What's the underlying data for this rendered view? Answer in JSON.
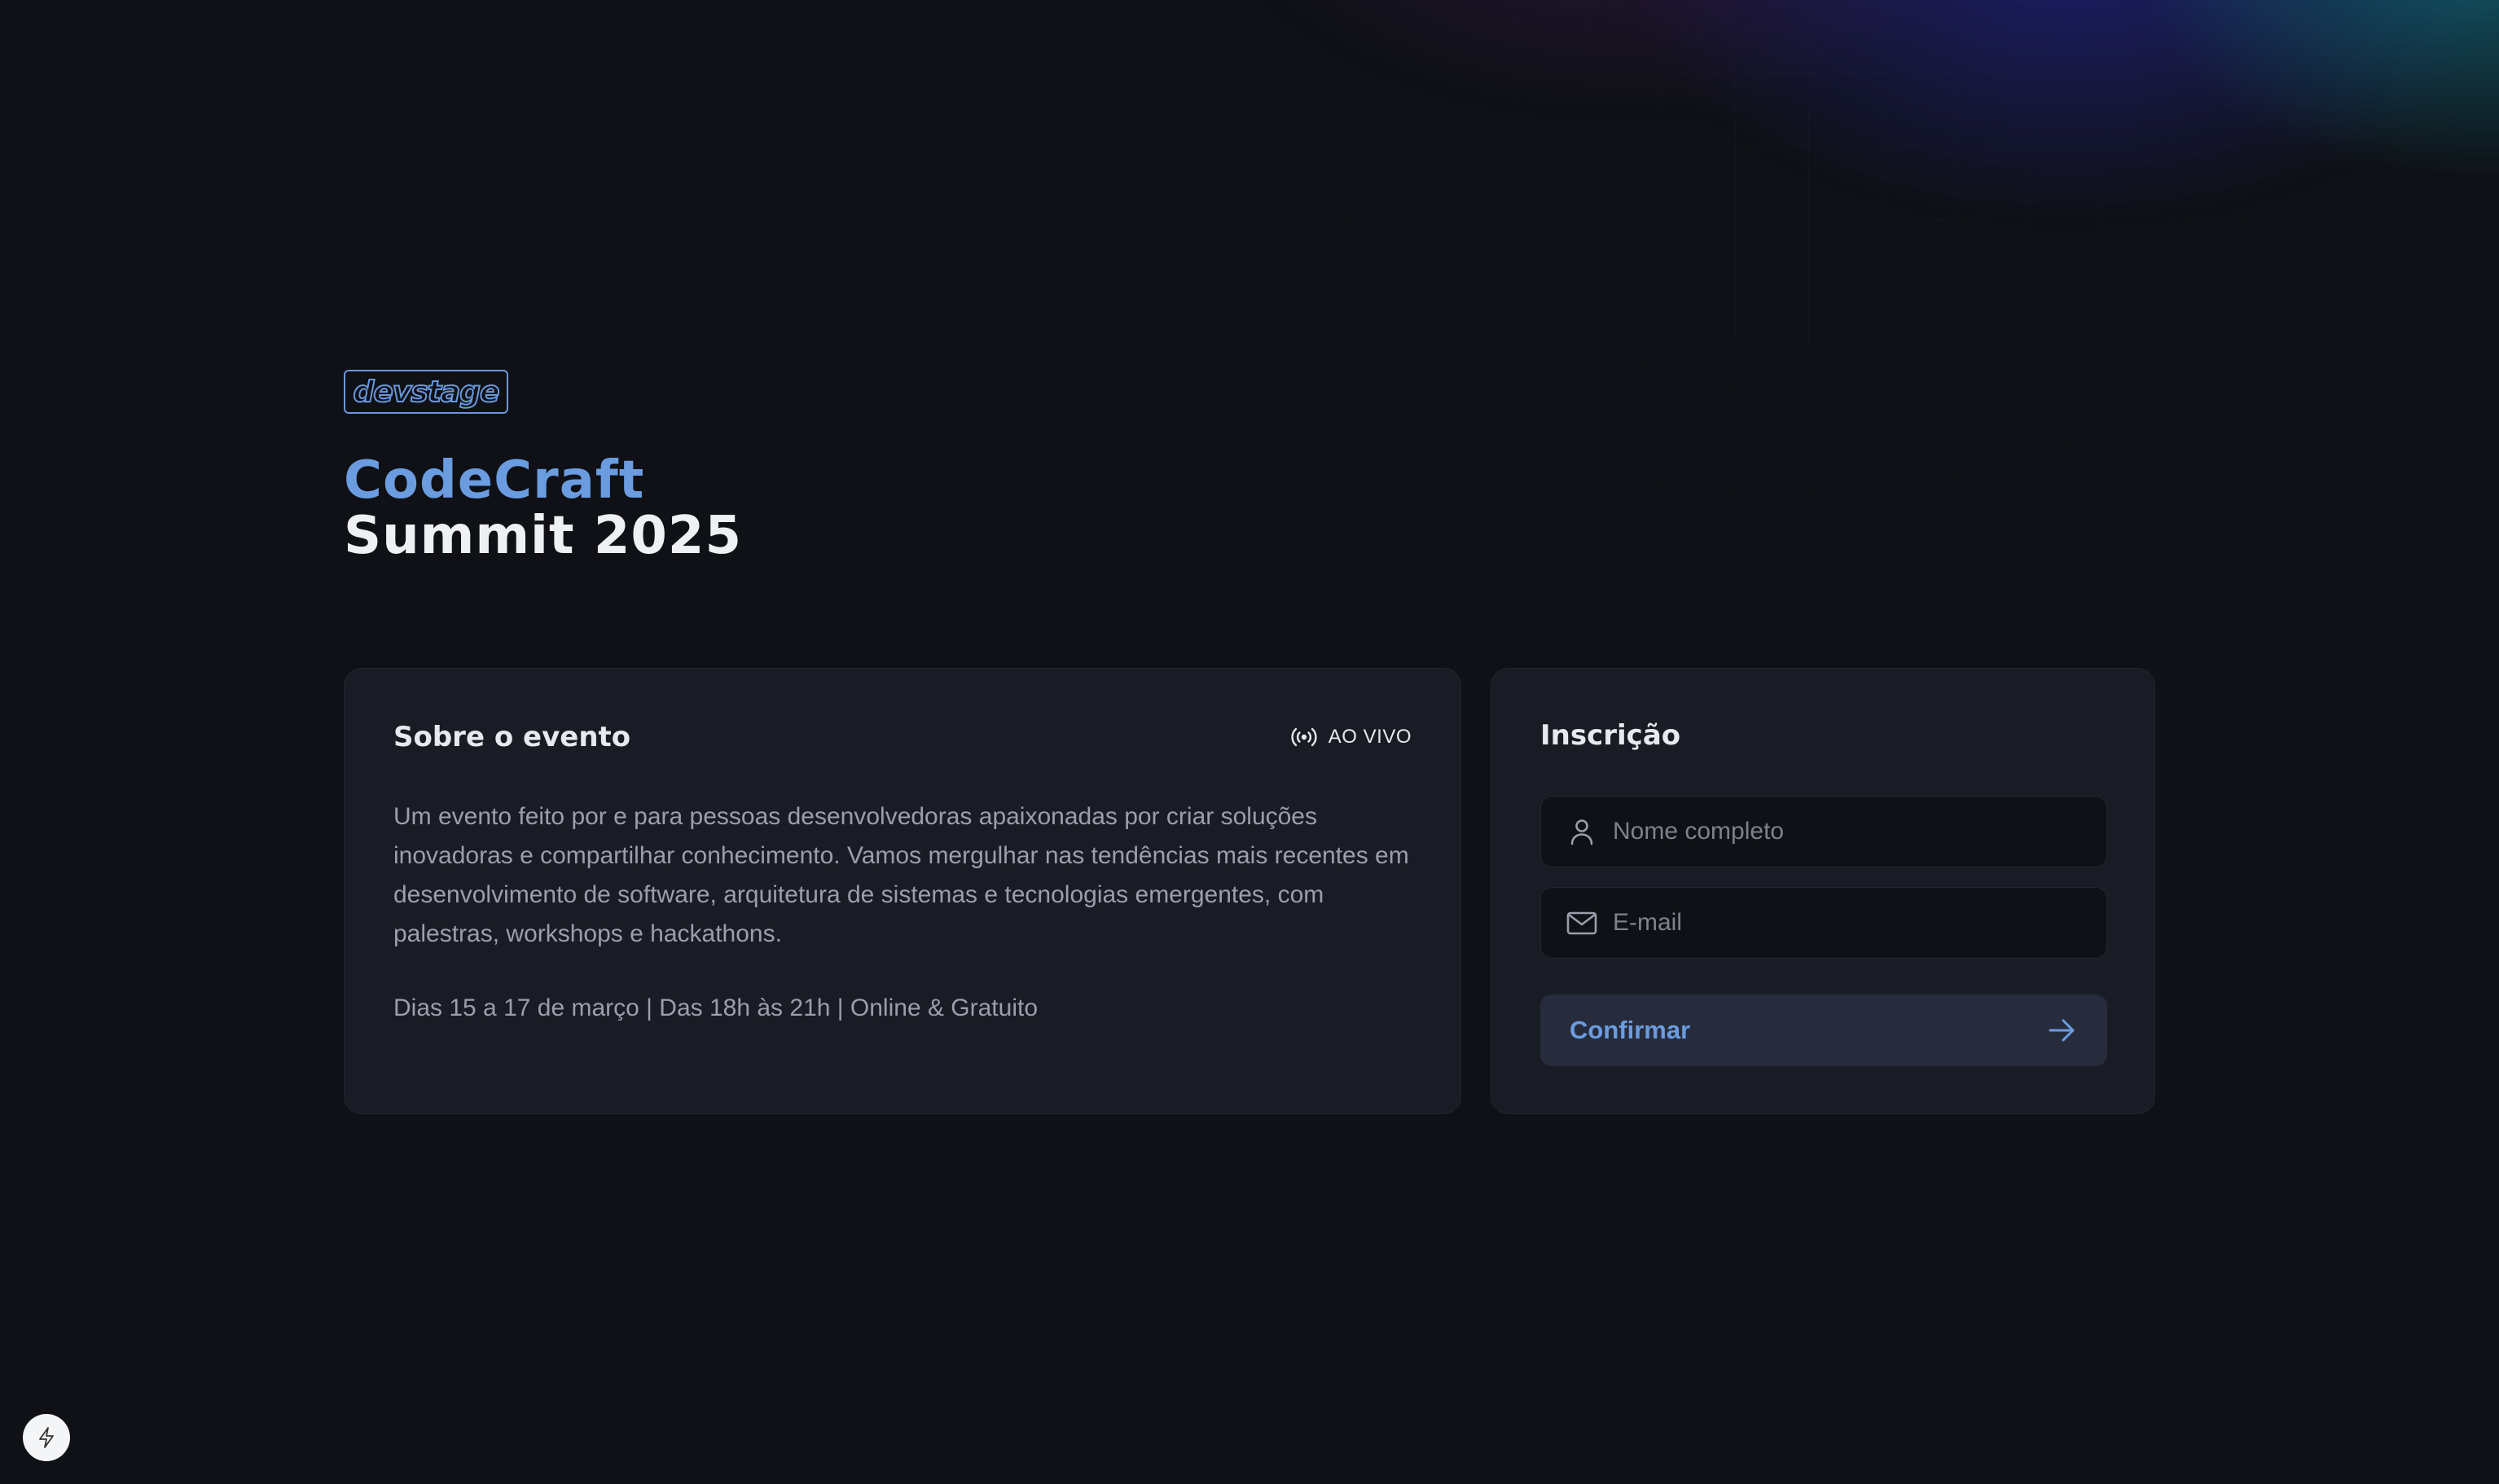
{
  "brand": {
    "logo_text": "devstage"
  },
  "hero": {
    "title_line1": "CodeCraft",
    "title_line2": "Summit 2025"
  },
  "about": {
    "title": "Sobre o evento",
    "live_label": "AO VIVO",
    "live_icon": "broadcast-icon",
    "description": "Um evento feito por e para pessoas desenvolvedoras apaixonadas por criar soluções inovadoras e compartilhar conhecimento. Vamos mergulhar nas tendências mais recentes em desenvolvimento de software, arquitetura de sistemas e tecnologias emergentes, com palestras, workshops e hackathons.",
    "schedule": "Dias 15 a 17 de março | Das 18h às 21h | Online & Gratuito"
  },
  "signup": {
    "title": "Inscrição",
    "name_field": {
      "placeholder": "Nome completo",
      "value": "",
      "icon": "user-icon"
    },
    "email_field": {
      "placeholder": "E-mail",
      "value": "",
      "icon": "mail-icon"
    },
    "submit_label": "Confirmar",
    "submit_icon": "arrow-right-icon"
  },
  "floating": {
    "icon": "lightning-bolt-icon"
  },
  "colors": {
    "background": "#0f1116",
    "card": "#191c24",
    "accent": "#6b9ce0",
    "button": "#262c3c",
    "muted_text": "#9a9fab"
  }
}
